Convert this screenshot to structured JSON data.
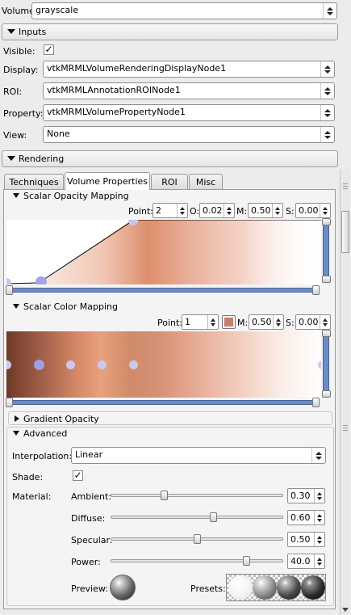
{
  "volume": {
    "label": "Volume:",
    "value": "grayscale"
  },
  "inputs": {
    "title": "Inputs",
    "visible_label": "Visible:",
    "visible_checked": true,
    "display_label": "Display:",
    "display_value": "vtkMRMLVolumeRenderingDisplayNode1",
    "roi_label": "ROI:",
    "roi_value": "vtkMRMLAnnotationROINode1",
    "property_label": "Property:",
    "property_value": "vtkMRMLVolumePropertyNode1",
    "view_label": "View:",
    "view_value": "None"
  },
  "rendering": {
    "title": "Rendering",
    "tabs": [
      "Techniques",
      "Volume Properties",
      "ROI",
      "Misc"
    ],
    "active_tab": "Volume Properties"
  },
  "scalar_opacity": {
    "title": "Scalar Opacity Mapping",
    "point_label": "Point:",
    "point_value": "2",
    "o_label": "O:",
    "o_value": "0.02",
    "m_label": "M:",
    "m_value": "0.50",
    "s_label": "S:",
    "s_value": "0.00"
  },
  "scalar_color": {
    "title": "Scalar Color Mapping",
    "point_label": "Point:",
    "point_value": "1",
    "swatch_color": "#c0806a",
    "m_label": "M:",
    "m_value": "0.50",
    "s_label": "S:",
    "s_value": "0.00"
  },
  "gradient_opacity": {
    "title": "Gradient Opacity"
  },
  "advanced": {
    "title": "Advanced",
    "interpolation_label": "Interpolation:",
    "interpolation_value": "Linear",
    "shade_label": "Shade:",
    "shade_checked": true,
    "material_label": "Material:",
    "ambient_label": "Ambient:",
    "ambient_value": "0.30",
    "ambient_level": 0.3,
    "diffuse_label": "Diffuse:",
    "diffuse_value": "0.60",
    "diffuse_level": 0.6,
    "specular_label": "Specular:",
    "specular_value": "0.50",
    "specular_level": 0.5,
    "power_label": "Power:",
    "power_value": "40.0",
    "power_level": 0.8,
    "preview_label": "Preview:",
    "presets_label": "Presets:"
  },
  "colors": {
    "ramp_color": "#e0906e",
    "ramp_dark": "#8a4f3b",
    "track_blue": "#6e8cc4"
  }
}
